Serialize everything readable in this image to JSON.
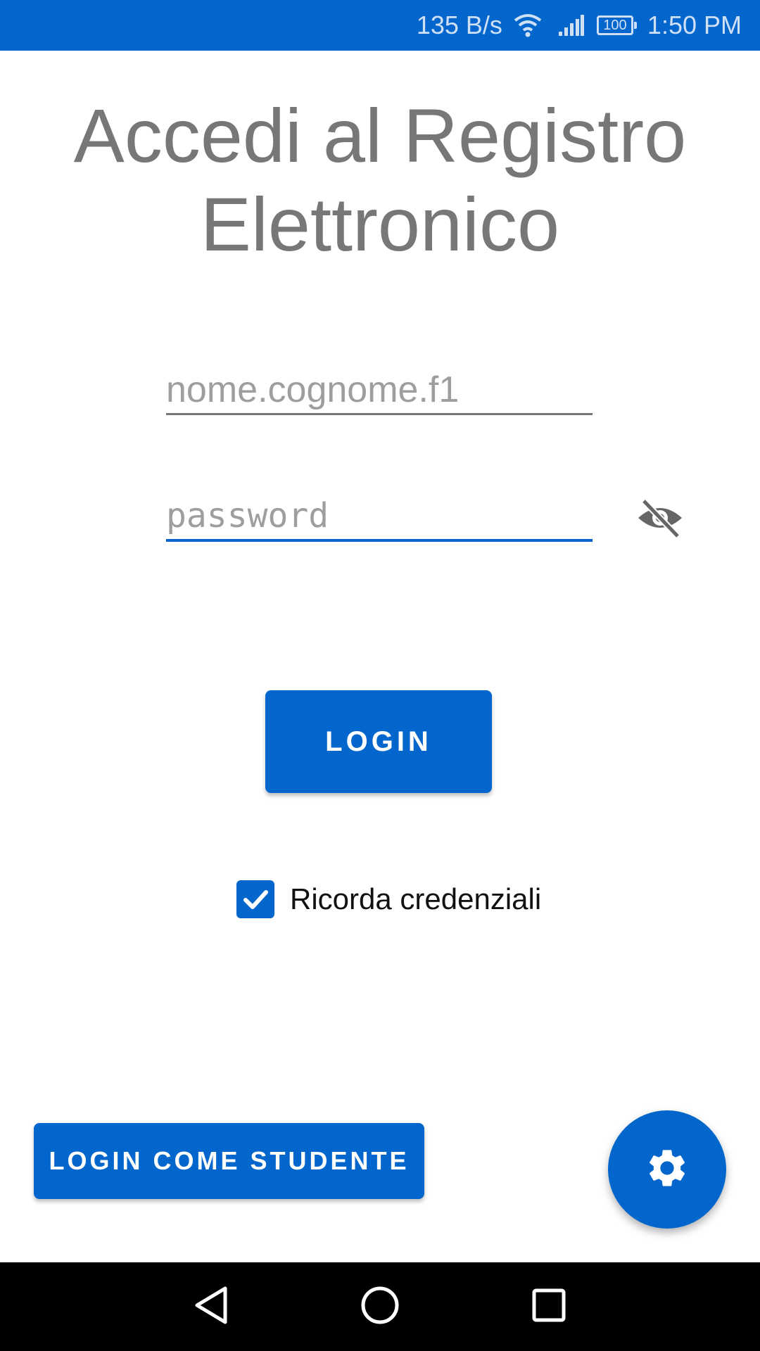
{
  "status_bar": {
    "network_speed": "135 B/s",
    "battery_level": "100",
    "time": "1:50 PM",
    "icons": [
      "wifi-icon",
      "signal-icon",
      "battery-icon"
    ]
  },
  "title": "Accedi al Registro Elettronico",
  "username": {
    "placeholder": "nome.cognome.f1",
    "value": ""
  },
  "password": {
    "placeholder": "password",
    "value": "",
    "visibility_icon": "eye-off-icon"
  },
  "login_button": {
    "label": "LOGIN"
  },
  "remember": {
    "label": "Ricorda credenziali",
    "checked": true
  },
  "student_login_button": {
    "label": "LOGIN COME STUDENTE"
  },
  "fab": {
    "icon": "gear-icon"
  },
  "nav_bar": {
    "icons": [
      "back-icon",
      "home-icon",
      "recents-icon"
    ]
  },
  "colors": {
    "primary": "#0366cc",
    "title_text": "#777777",
    "placeholder": "#9e9e9e"
  }
}
